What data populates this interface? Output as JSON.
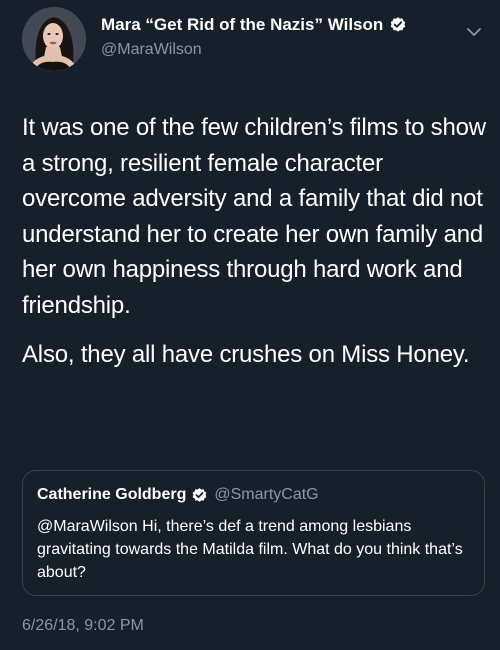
{
  "colors": {
    "background": "#15202b",
    "text_primary": "#ffffff",
    "text_secondary": "#8899a6",
    "verified_badge": "#ffffff",
    "card_border": "#38444d"
  },
  "tweet": {
    "author": {
      "name": "Mara “Get Rid of the Nazis” Wilson",
      "handle": "@MaraWilson",
      "verified": true,
      "avatar_icon": "profile-photo"
    },
    "menu_icon": "chevron-down-icon",
    "text": {
      "paragraph_1": "It was one of the few children’s films to show a strong, resilient female character overcome adversity and a family that did not understand her to create her own family and her own happiness through hard work and friendship.",
      "paragraph_2": "Also, they all have crushes on Miss Honey."
    },
    "quoted_tweet": {
      "author_name": "Catherine Goldberg",
      "author_handle": "@SmartyCatG",
      "verified": true,
      "text": "@MaraWilson Hi, there’s def a trend among lesbians gravitating towards the Matilda film. What do you think that’s about?"
    },
    "timestamp": "6/26/18, 9:02 PM"
  }
}
